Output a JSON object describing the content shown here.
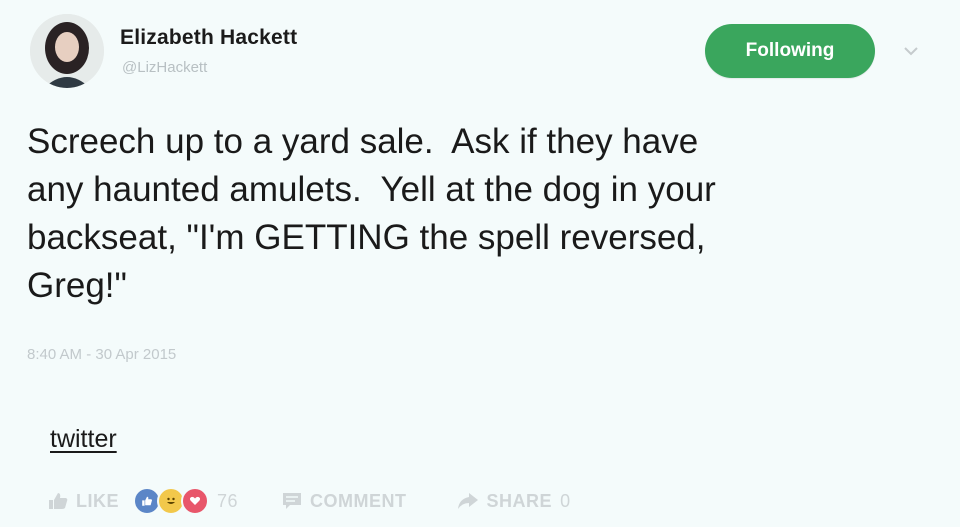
{
  "author": {
    "name": "Elizabeth Hackett",
    "handle": "@LizHackett"
  },
  "follow_button": {
    "label": "Following",
    "color": "#3aa65d"
  },
  "tweet": {
    "text": "Screech up to a yard sale.  Ask if they have\nany haunted amulets.  Yell at the dog in your\nbackseat, \"I'm GETTING the spell reversed,\nGreg!\"",
    "timestamp": "8:40 AM - 30 Apr 2015"
  },
  "source": {
    "label": "twitter"
  },
  "actions": {
    "like_label": "LIKE",
    "reaction_count": "76",
    "comment_label": "COMMENT",
    "share_label": "SHARE",
    "share_count": "0"
  },
  "icons": [
    "chevron-down-icon",
    "thumbs-up-icon",
    "comment-icon",
    "share-icon"
  ]
}
